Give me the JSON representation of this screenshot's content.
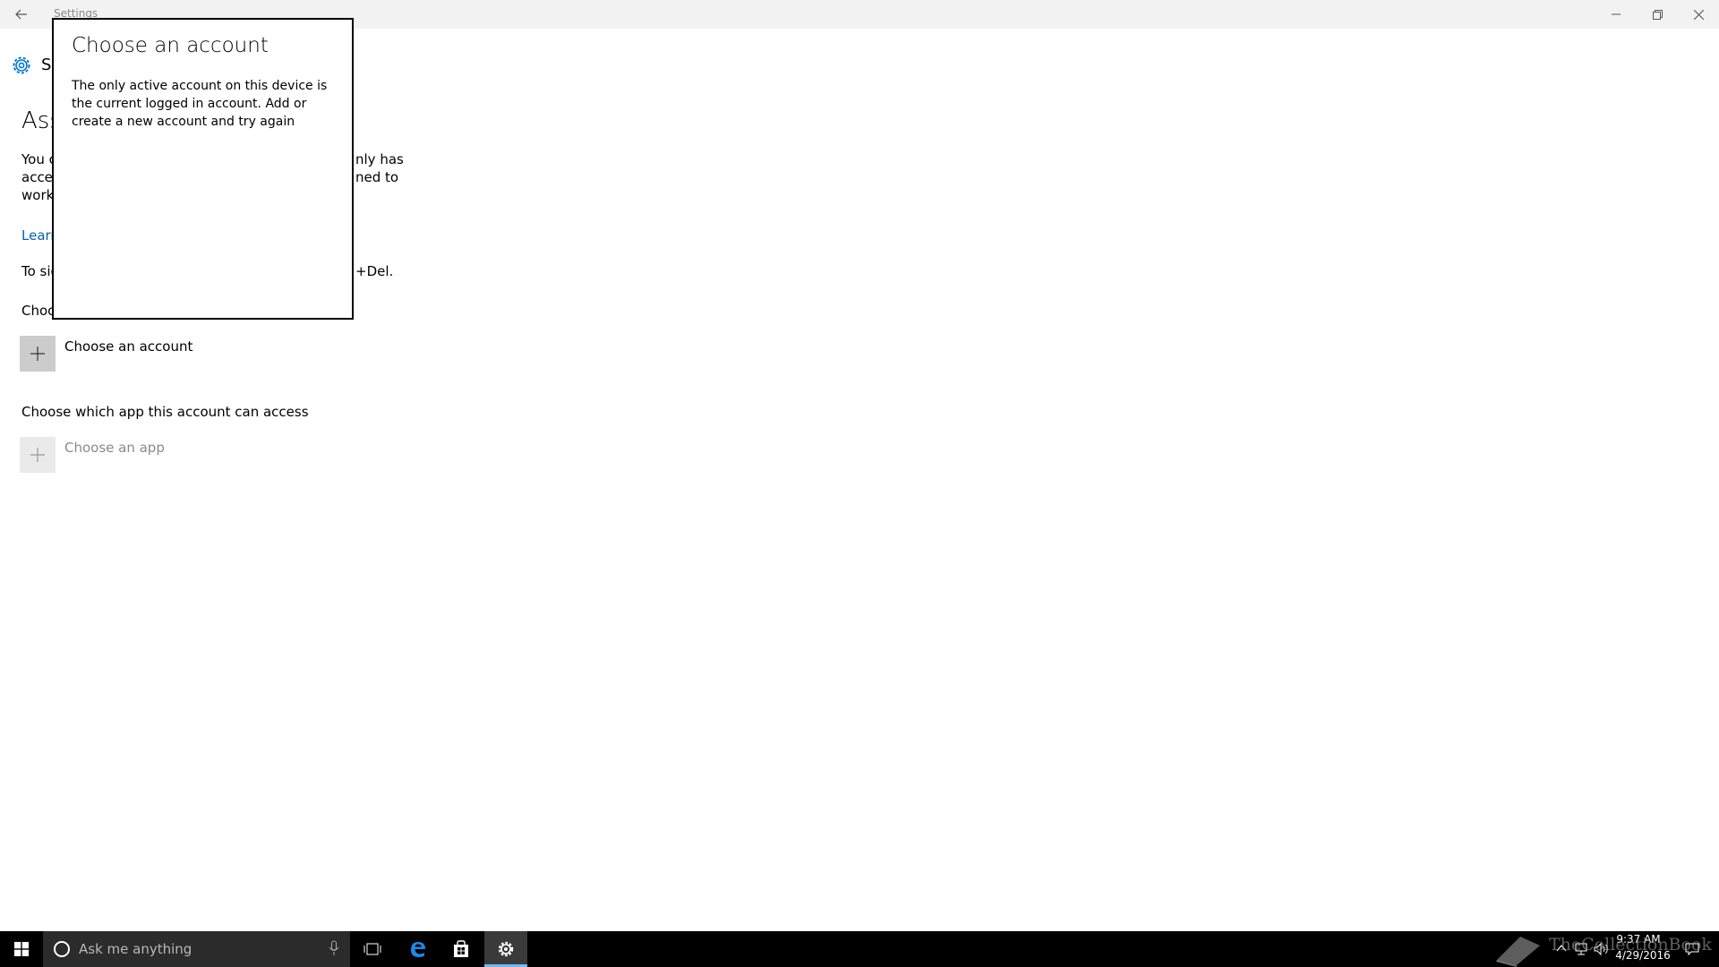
{
  "window": {
    "title": "Settings",
    "back_icon": "arrow-left-icon"
  },
  "header": {
    "text": "Se",
    "icon": "gear-icon",
    "accent": "#0078d7"
  },
  "page": {
    "title": "Ass",
    "desc_left": "You c\nacces\nwork",
    "desc_right": "nly has\nned to",
    "learn_link": "Learn",
    "signout_left": "To sig",
    "signout_right": "+Del.",
    "choose_account_label": "Choo",
    "choose_account_button": "Choose an account",
    "choose_app_label": "Choose which app this account can access",
    "choose_app_button": "Choose an app"
  },
  "flyout": {
    "title": "Choose an account",
    "message": "The only active account on this device is the current logged in account. Add or create a new account and try again"
  },
  "taskbar": {
    "search_placeholder": "Ask me anything",
    "time": "9:37 AM",
    "date": "4/29/2016",
    "watermark": "TheCollectionBook",
    "active_highlight": "#76b9ed"
  }
}
